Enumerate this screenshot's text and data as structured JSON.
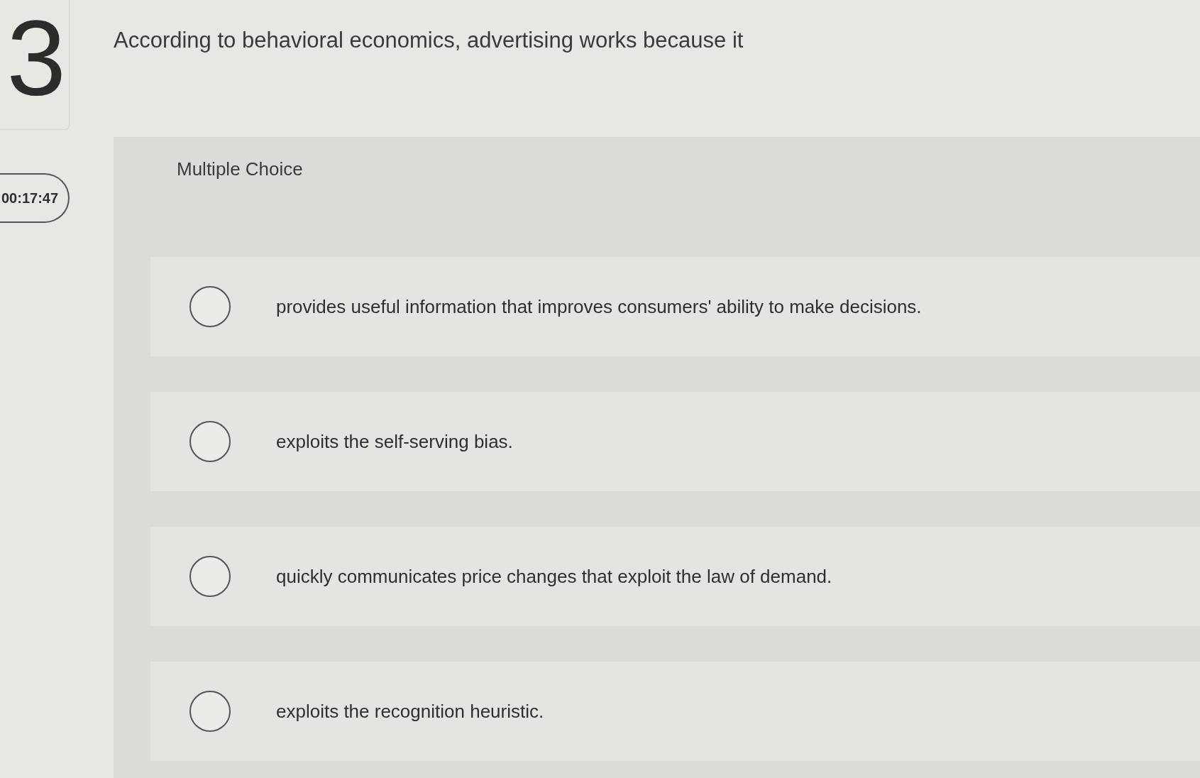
{
  "question_number": "3",
  "timer": "00:17:47",
  "question": "According to behavioral economics, advertising works because it",
  "question_type": "Multiple Choice",
  "options": [
    {
      "label": "provides useful information that improves consumers' ability to make decisions.",
      "selected": false
    },
    {
      "label": "exploits the self-serving bias.",
      "selected": false
    },
    {
      "label": "quickly communicates price changes that exploit the law of demand.",
      "selected": false
    },
    {
      "label": "exploits the recognition heuristic.",
      "selected": false
    }
  ]
}
